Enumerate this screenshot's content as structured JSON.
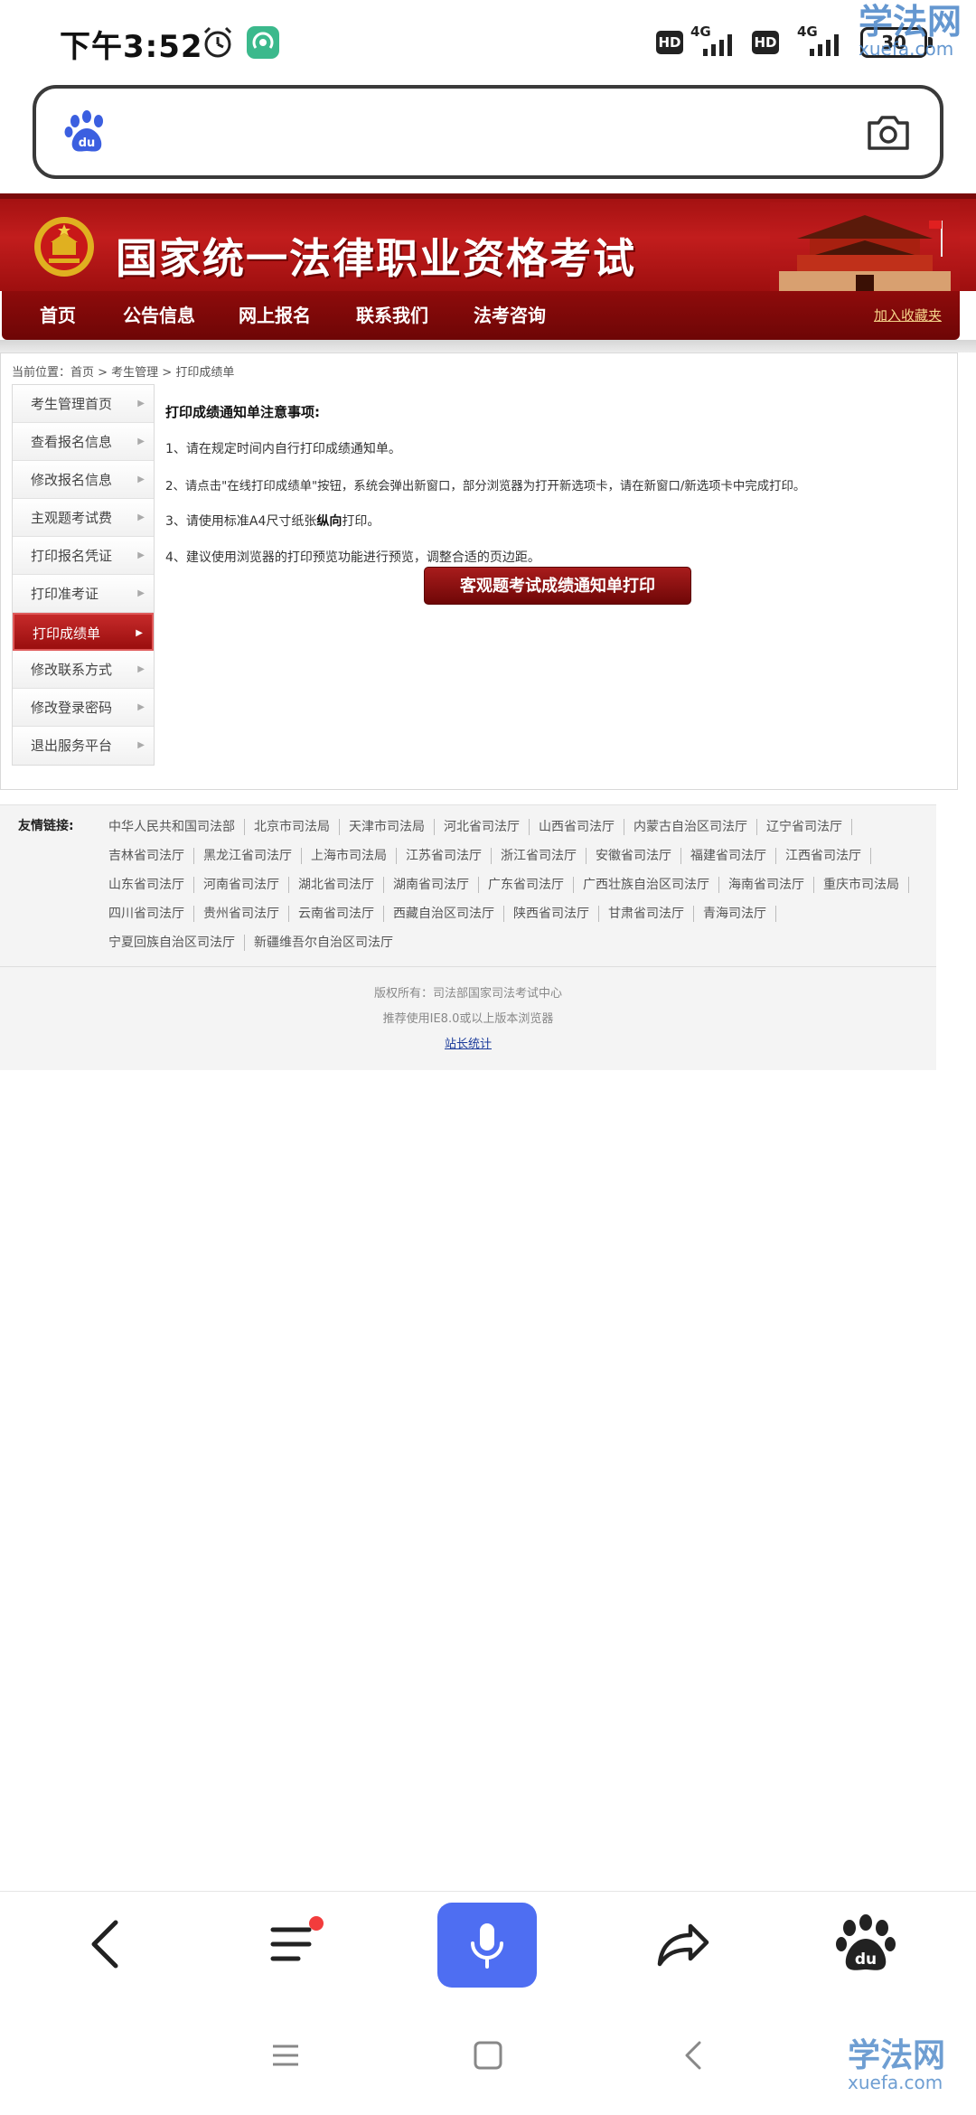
{
  "status_bar": {
    "time": "下午3:52",
    "hd1": "HD",
    "net1": "4G",
    "hd2": "HD",
    "net2": "4G",
    "battery": "30"
  },
  "watermark": {
    "name": "学法网",
    "domain": "xuefa.com"
  },
  "search": {
    "placeholder": "",
    "logo": "baidu-paw-icon",
    "camera": "camera-icon"
  },
  "site": {
    "title": "国家统一法律职业资格考试",
    "nav": [
      "首页",
      "公告信息",
      "网上报名",
      "联系我们",
      "法考咨询"
    ],
    "favorite": "加入收藏夹"
  },
  "breadcrumb": "当前位置：首页 > 考生管理 > 打印成绩单",
  "menu": [
    {
      "label": "考生管理首页",
      "active": false
    },
    {
      "label": "查看报名信息",
      "active": false
    },
    {
      "label": "修改报名信息",
      "active": false
    },
    {
      "label": "主观题考试费",
      "active": false
    },
    {
      "label": "打印报名凭证",
      "active": false
    },
    {
      "label": "打印准考证",
      "active": false
    },
    {
      "label": "打印成绩单",
      "active": true
    },
    {
      "label": "修改联系方式",
      "active": false
    },
    {
      "label": "修改登录密码",
      "active": false
    },
    {
      "label": "退出服务平台",
      "active": false
    }
  ],
  "notice": {
    "title": "打印成绩通知单注意事项:",
    "item1": "1、请在规定时间内自行打印成绩通知单。",
    "item2": "2、请点击\"在线打印成绩单\"按钮，系统会弹出新窗口，部分浏览器为打开新选项卡，请在新窗口/新选项卡中完成打印。",
    "item3_pre": "3、请使用标准A4尺寸纸张",
    "item3_bold": "纵向",
    "item3_post": "打印。",
    "item4": "4、建议使用浏览器的打印预览功能进行预览，调整合适的页边距。",
    "button": "客观题考试成绩通知单打印"
  },
  "links": {
    "label": "友情链接:",
    "items": [
      "中华人民共和国司法部",
      "北京市司法局",
      "天津市司法局",
      "河北省司法厅",
      "山西省司法厅",
      "内蒙古自治区司法厅",
      "辽宁省司法厅",
      "吉林省司法厅",
      "黑龙江省司法厅",
      "上海市司法局",
      "江苏省司法厅",
      "浙江省司法厅",
      "安徽省司法厅",
      "福建省司法厅",
      "江西省司法厅",
      "山东省司法厅",
      "河南省司法厅",
      "湖北省司法厅",
      "湖南省司法厅",
      "广东省司法厅",
      "广西壮族自治区司法厅",
      "海南省司法厅",
      "重庆市司法局",
      "四川省司法厅",
      "贵州省司法厅",
      "云南省司法厅",
      "西藏自治区司法厅",
      "陕西省司法厅",
      "甘肃省司法厅",
      "青海司法厅",
      "宁夏回族自治区司法厅",
      "新疆维吾尔自治区司法厅"
    ]
  },
  "footer": {
    "copyright": "版权所有：司法部国家司法考试中心",
    "browser": "推荐使用IE8.0或以上版本浏览器",
    "stats": "站长统计"
  },
  "toolbar": {
    "back": "back-arrow-icon",
    "menu": "menu-lines-icon",
    "mic": "microphone-icon",
    "share": "share-arrow-icon",
    "baidu": "baidu-paw-icon"
  },
  "colors": {
    "brand_red": "#a01010",
    "nav_red": "#7a0707",
    "accent_blue": "#4e6ef2",
    "badge_red": "#f23c3c"
  }
}
